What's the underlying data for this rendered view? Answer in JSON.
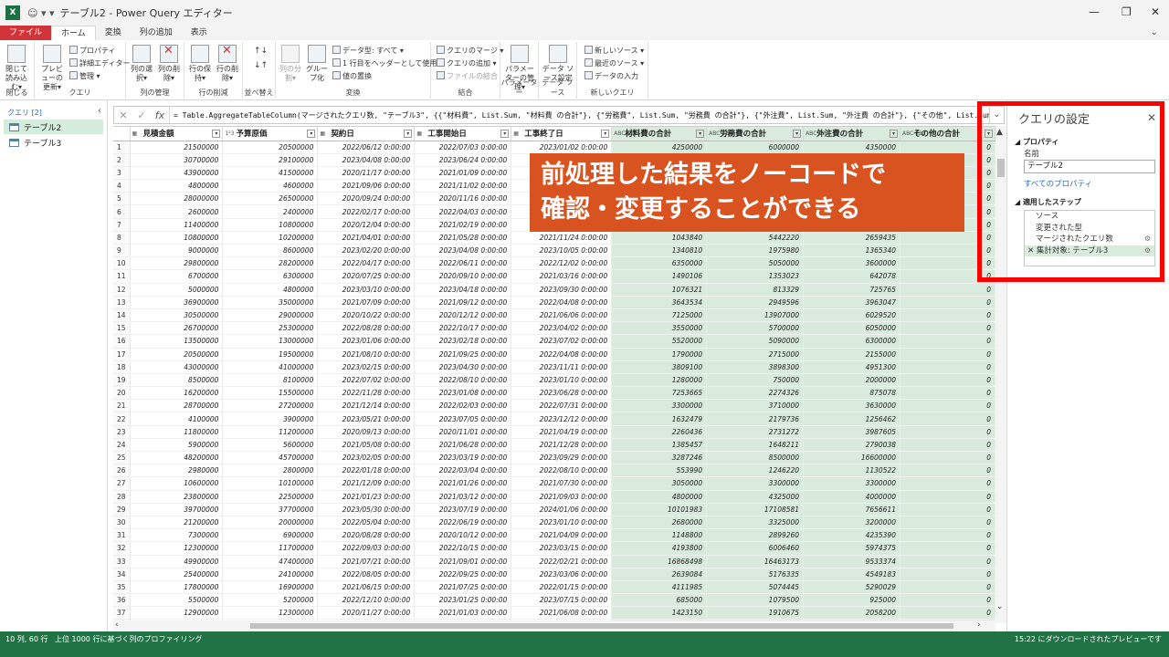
{
  "window": {
    "title": "テーブル2 - Power Query エディター",
    "excel_badge": "X",
    "quick_access": "☺ ▾ ▾"
  },
  "ribbon_tabs": [
    "ファイル",
    "ホーム",
    "変換",
    "列の追加",
    "表示"
  ],
  "ribbon": {
    "close_load": "閉じて読み込む▾",
    "preview_refresh": "プレビューの更新▾",
    "properties": "プロパティ",
    "advanced_editor": "詳細エディター",
    "manage": "管理 ▾",
    "choose_columns": "列の選択▾",
    "remove_columns": "列の削除▾",
    "keep_rows": "行の保持▾",
    "remove_rows": "行の削除▾",
    "split_column": "列の分割▾",
    "group_by": "グループ化",
    "data_type": "データ型: すべて ▾",
    "first_row_header": "1 行目をヘッダーとして使用 ▾",
    "replace_values": "値の置換",
    "merge_queries": "クエリのマージ ▾",
    "append_queries": "クエリの追加 ▾",
    "combine_files": "ファイルの結合",
    "manage_parameters": "パラメーターの管理▾",
    "data_source_settings": "データ ソース設定",
    "new_source": "新しいソース ▾",
    "recent_sources": "最近のソース ▾",
    "enter_data": "データの入力",
    "groups": {
      "close": "閉じる",
      "query": "クエリ",
      "manage_columns": "列の管理",
      "reduce_rows": "行の削減",
      "sort": "並べ替え",
      "transform": "変換",
      "combine": "結合",
      "parameters": "パラメーター",
      "data_sources": "データ ソース",
      "new_query": "新しいクエリ"
    }
  },
  "queries_pane": {
    "header": "クエリ [2]",
    "items": [
      {
        "name": "テーブル2",
        "selected": true
      },
      {
        "name": "テーブル3",
        "selected": false
      }
    ]
  },
  "formula": "= Table.AggregateTableColumn(マージされたクエリ数, \"テーブル3\", {{\"材料費\", List.Sum, \"材料費 の合計\"}, {\"労務費\", List.Sum, \"労務費 の合計\"}, {\"外注費\", List.Sum, \"外注費 の合計\"}, {\"その他\", List.Sum, \"",
  "table": {
    "columns": [
      {
        "type": "▦",
        "name": "見積金額"
      },
      {
        "type": "1²3",
        "name": "予算原価"
      },
      {
        "type": "▦",
        "name": "契約日"
      },
      {
        "type": "▦",
        "name": "工事開始日"
      },
      {
        "type": "▦",
        "name": "工事終了日"
      },
      {
        "type": "ABC 123",
        "name": "材料費の合計"
      },
      {
        "type": "ABC 123",
        "name": "労務費の合計"
      },
      {
        "type": "ABC 123",
        "name": "外注費の合計"
      },
      {
        "type": "ABC 123",
        "name": "その他の合計"
      }
    ],
    "rows": [
      [
        "1",
        "21500000",
        "20500000",
        "2022/06/12 0:00:00",
        "2022/07/03 0:00:00",
        "2023/01/02 0:00:00",
        "4250000",
        "6000000",
        "4350000",
        "0"
      ],
      [
        "2",
        "30700000",
        "29100000",
        "2023/04/08 0:00:00",
        "2023/06/24 0:00:00",
        "",
        "",
        "",
        "",
        "0"
      ],
      [
        "3",
        "43900000",
        "41500000",
        "2020/11/17 0:00:00",
        "2021/01/09 0:00:00",
        "",
        "",
        "",
        "",
        "0"
      ],
      [
        "4",
        "4800000",
        "4600000",
        "2021/09/06 0:00:00",
        "2021/11/02 0:00:00",
        "",
        "",
        "",
        "",
        "0"
      ],
      [
        "5",
        "28000000",
        "26500000",
        "2020/09/24 0:00:00",
        "2020/11/16 0:00:00",
        "",
        "",
        "",
        "",
        "0"
      ],
      [
        "6",
        "2600000",
        "2400000",
        "2022/02/17 0:00:00",
        "2022/04/03 0:00:00",
        "",
        "",
        "",
        "",
        "0"
      ],
      [
        "7",
        "11400000",
        "10800000",
        "2020/12/04 0:00:00",
        "2021/02/19 0:00:00",
        "",
        "",
        "",
        "",
        "0"
      ],
      [
        "8",
        "10800000",
        "10200000",
        "2021/04/01 0:00:00",
        "2021/05/28 0:00:00",
        "2021/11/24 0:00:00",
        "1043840",
        "5442220",
        "2659435",
        "0"
      ],
      [
        "9",
        "9000000",
        "8600000",
        "2023/02/20 0:00:00",
        "2023/04/08 0:00:00",
        "2023/10/05 0:00:00",
        "1340810",
        "1975980",
        "1365340",
        "0"
      ],
      [
        "10",
        "29800000",
        "28200000",
        "2022/04/17 0:00:00",
        "2022/06/11 0:00:00",
        "2022/12/02 0:00:00",
        "6350000",
        "5050000",
        "3600000",
        "0"
      ],
      [
        "11",
        "6700000",
        "6300000",
        "2020/07/25 0:00:00",
        "2020/09/10 0:00:00",
        "2021/03/16 0:00:00",
        "1490106",
        "1353023",
        "642078",
        "0"
      ],
      [
        "12",
        "5000000",
        "4800000",
        "2023/03/10 0:00:00",
        "2023/04/18 0:00:00",
        "2023/09/30 0:00:00",
        "1076321",
        "813329",
        "725765",
        "0"
      ],
      [
        "13",
        "36900000",
        "35000000",
        "2021/07/09 0:00:00",
        "2021/09/12 0:00:00",
        "2022/04/08 0:00:00",
        "3643534",
        "2949596",
        "3963047",
        "0"
      ],
      [
        "14",
        "30500000",
        "29000000",
        "2020/10/22 0:00:00",
        "2020/12/12 0:00:00",
        "2021/06/06 0:00:00",
        "7125000",
        "13907000",
        "6029520",
        "0"
      ],
      [
        "15",
        "26700000",
        "25300000",
        "2022/08/28 0:00:00",
        "2022/10/17 0:00:00",
        "2023/04/02 0:00:00",
        "3550000",
        "5700000",
        "6050000",
        "0"
      ],
      [
        "16",
        "13500000",
        "13000000",
        "2023/01/06 0:00:00",
        "2023/02/18 0:00:00",
        "2023/07/02 0:00:00",
        "5520000",
        "5090000",
        "6300000",
        "0"
      ],
      [
        "17",
        "20500000",
        "19500000",
        "2021/08/10 0:00:00",
        "2021/09/25 0:00:00",
        "2022/04/08 0:00:00",
        "1790000",
        "2715000",
        "2155000",
        "0"
      ],
      [
        "18",
        "43000000",
        "41000000",
        "2023/02/15 0:00:00",
        "2023/04/30 0:00:00",
        "2023/11/11 0:00:00",
        "3809100",
        "3898300",
        "4951300",
        "0"
      ],
      [
        "19",
        "8500000",
        "8100000",
        "2022/07/02 0:00:00",
        "2022/08/10 0:00:00",
        "2023/01/10 0:00:00",
        "1280000",
        "750000",
        "2000000",
        "0"
      ],
      [
        "20",
        "16200000",
        "15500000",
        "2022/11/28 0:00:00",
        "2023/01/08 0:00:00",
        "2023/06/28 0:00:00",
        "7253665",
        "2274326",
        "875078",
        "0"
      ],
      [
        "21",
        "28700000",
        "27200000",
        "2021/12/14 0:00:00",
        "2022/02/03 0:00:00",
        "2022/07/31 0:00:00",
        "3300000",
        "3710000",
        "3630000",
        "0"
      ],
      [
        "22",
        "4100000",
        "3900000",
        "2023/05/21 0:00:00",
        "2023/07/05 0:00:00",
        "2023/12/12 0:00:00",
        "1632479",
        "2179736",
        "1256462",
        "0"
      ],
      [
        "23",
        "11800000",
        "11200000",
        "2020/09/13 0:00:00",
        "2020/11/01 0:00:00",
        "2021/04/19 0:00:00",
        "2260436",
        "2731272",
        "3987605",
        "0"
      ],
      [
        "24",
        "5900000",
        "5600000",
        "2021/05/08 0:00:00",
        "2021/06/28 0:00:00",
        "2021/12/28 0:00:00",
        "1385457",
        "1648211",
        "2790038",
        "0"
      ],
      [
        "25",
        "48200000",
        "45700000",
        "2023/02/05 0:00:00",
        "2023/03/19 0:00:00",
        "2023/09/29 0:00:00",
        "3287246",
        "8500000",
        "16600000",
        "0"
      ],
      [
        "26",
        "2980000",
        "2800000",
        "2022/01/18 0:00:00",
        "2022/03/04 0:00:00",
        "2022/08/10 0:00:00",
        "553990",
        "1246220",
        "1130522",
        "0"
      ],
      [
        "27",
        "10600000",
        "10100000",
        "2021/12/09 0:00:00",
        "2021/01/26 0:00:00",
        "2021/07/30 0:00:00",
        "3050000",
        "3300000",
        "3300000",
        "0"
      ],
      [
        "28",
        "23800000",
        "22500000",
        "2021/01/23 0:00:00",
        "2021/03/12 0:00:00",
        "2021/09/03 0:00:00",
        "4800000",
        "4325000",
        "4000000",
        "0"
      ],
      [
        "29",
        "39700000",
        "37700000",
        "2023/05/30 0:00:00",
        "2023/07/19 0:00:00",
        "2024/01/06 0:00:00",
        "10101983",
        "17108581",
        "7656611",
        "0"
      ],
      [
        "30",
        "21200000",
        "20000000",
        "2022/05/04 0:00:00",
        "2022/06/19 0:00:00",
        "2023/01/10 0:00:00",
        "2680000",
        "3325000",
        "3200000",
        "0"
      ],
      [
        "31",
        "7300000",
        "6900000",
        "2020/08/28 0:00:00",
        "2020/10/12 0:00:00",
        "2021/04/09 0:00:00",
        "1148800",
        "2899260",
        "4235390",
        "0"
      ],
      [
        "32",
        "12300000",
        "11700000",
        "2022/09/03 0:00:00",
        "2022/10/15 0:00:00",
        "2023/03/15 0:00:00",
        "4193800",
        "6006460",
        "5974375",
        "0"
      ],
      [
        "33",
        "49900000",
        "47400000",
        "2021/07/21 0:00:00",
        "2021/09/01 0:00:00",
        "2022/02/21 0:00:00",
        "16868498",
        "16463173",
        "9533374",
        "0"
      ],
      [
        "34",
        "25400000",
        "24100000",
        "2022/08/05 0:00:00",
        "2022/09/25 0:00:00",
        "2023/03/06 0:00:00",
        "2639084",
        "5176335",
        "4549183",
        "0"
      ],
      [
        "35",
        "17800000",
        "16900000",
        "2021/06/15 0:00:00",
        "2021/07/25 0:00:00",
        "2022/01/15 0:00:00",
        "4111985",
        "5074445",
        "5290029",
        "0"
      ],
      [
        "36",
        "5500000",
        "5200000",
        "2022/12/10 0:00:00",
        "2023/01/25 0:00:00",
        "2023/07/15 0:00:00",
        "685000",
        "1079500",
        "925000",
        "0"
      ],
      [
        "37",
        "12900000",
        "12300000",
        "2020/11/27 0:00:00",
        "2021/01/03 0:00:00",
        "2021/06/08 0:00:00",
        "1423150",
        "1910675",
        "2058200",
        "0"
      ],
      [
        "38",
        "31600000",
        "30000000",
        "2021/10/19 0:00:00",
        "2021/12/01 0:00:00",
        "2022/05/24 0:00:00",
        "6150000",
        "5080000",
        "4460000",
        "0"
      ]
    ]
  },
  "settings": {
    "title": "クエリの設定",
    "properties_section": "◢ プロパティ",
    "name_label": "名前",
    "name_value": "テーブル2",
    "all_properties": "すべてのプロパティ",
    "steps_section": "◢ 適用したステップ",
    "steps": [
      {
        "label": "ソース",
        "gear": false,
        "selected": false
      },
      {
        "label": "変更された型",
        "gear": false,
        "selected": false
      },
      {
        "label": "マージされたクエリ数",
        "gear": true,
        "selected": false
      },
      {
        "label": "✕ 集計対象: テーブル3",
        "gear": true,
        "selected": true
      }
    ]
  },
  "callout": {
    "line1": "前処理した結果をノーコードで",
    "line2": "確認・変更することができる"
  },
  "status": {
    "left": "10 列, 60 行",
    "middle": "上位 1000 行に基づく列のプロファイリング",
    "right": "15:22 にダウンロードされたプレビューです"
  },
  "colors": {
    "accent_green": "#217346",
    "file_tab": "#d13438",
    "callout_bg": "#d8531f",
    "highlight_frame": "#ff0000",
    "selected_cols": "#d8ebdd"
  }
}
